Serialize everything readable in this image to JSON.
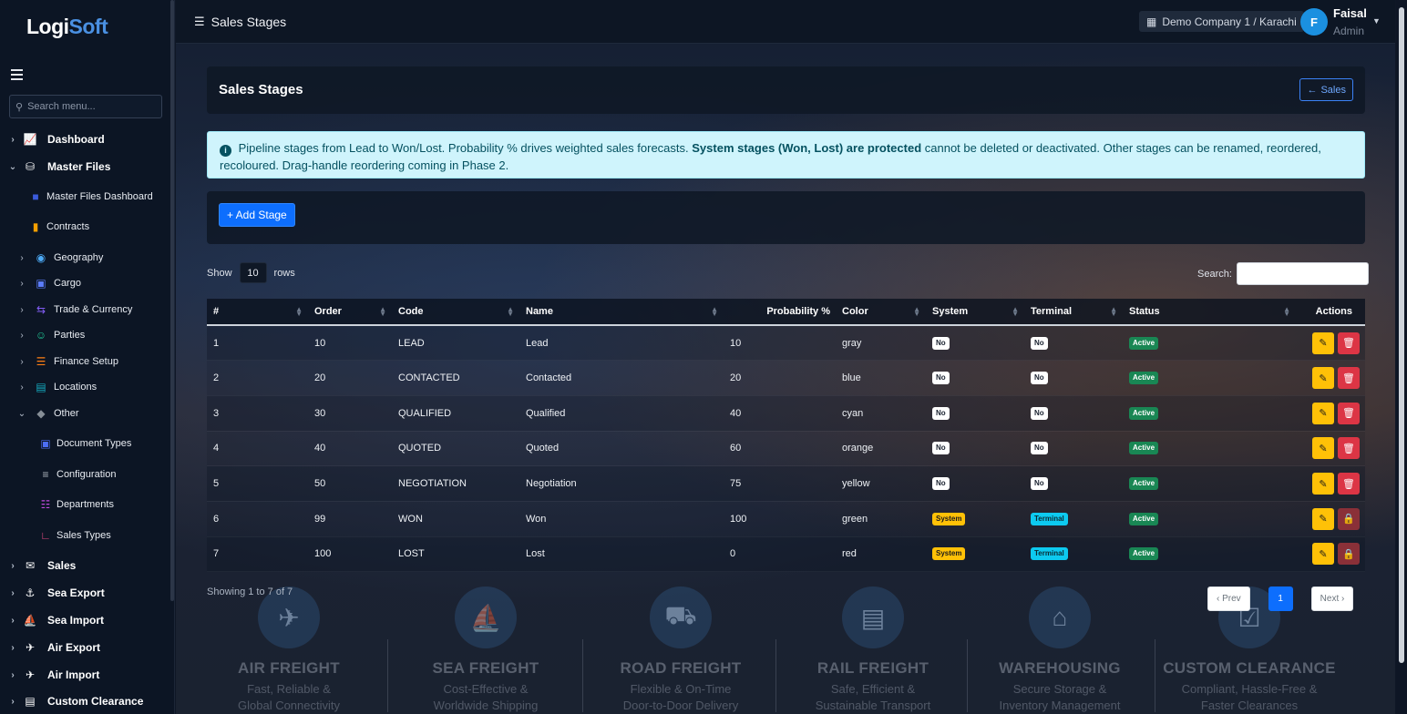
{
  "sidebar": {
    "logo_main": "Logi",
    "logo_accent": "Soft",
    "search_placeholder": "Search menu...",
    "items": [
      {
        "label": "Dashboard"
      },
      {
        "label": "Master Files"
      },
      {
        "label": "Master Files Dashboard"
      },
      {
        "label": "Contracts"
      },
      {
        "label": "Geography"
      },
      {
        "label": "Cargo"
      },
      {
        "label": "Trade & Currency"
      },
      {
        "label": "Parties"
      },
      {
        "label": "Finance Setup"
      },
      {
        "label": "Locations"
      },
      {
        "label": "Other"
      },
      {
        "label": "Document Types"
      },
      {
        "label": "Configuration"
      },
      {
        "label": "Departments"
      },
      {
        "label": "Sales Types"
      },
      {
        "label": "Sales"
      },
      {
        "label": "Sea Export"
      },
      {
        "label": "Sea Import"
      },
      {
        "label": "Air Export"
      },
      {
        "label": "Air Import"
      },
      {
        "label": "Custom Clearance"
      }
    ]
  },
  "topbar": {
    "title": "Sales Stages",
    "company": "Demo Company 1 / Karachi",
    "user_initial": "F",
    "user_name": "Faisal",
    "user_role": "Admin"
  },
  "page": {
    "heading": "Sales Stages",
    "back_label": "Sales",
    "alert_pre": "Pipeline stages from Lead to Won/Lost. Probability % drives weighted sales forecasts.",
    "alert_bold": "System stages (Won, Lost) are protected",
    "alert_post": "cannot be deleted or deactivated. Other stages can be renamed, reordered, recoloured. Drag-handle reordering coming in Phase 2.",
    "add_label": "+ Add Stage",
    "show_label": "Show",
    "page_len": "10",
    "rows_label": "rows",
    "search_label": "Search:",
    "info": "Showing 1 to 7 of 7",
    "prev_label": "‹ Prev",
    "page_num": "1",
    "next_label": "Next ›"
  },
  "table": {
    "headers": [
      "#",
      "Order",
      "Code",
      "Name",
      "Probability %",
      "Color",
      "System",
      "Terminal",
      "Status",
      "Actions"
    ],
    "rows": [
      {
        "n": "1",
        "order": "10",
        "code": "LEAD",
        "name": "Lead",
        "prob": "10",
        "color": "gray",
        "system": "No",
        "terminal": "No",
        "status": "Active",
        "locked": false
      },
      {
        "n": "2",
        "order": "20",
        "code": "CONTACTED",
        "name": "Contacted",
        "prob": "20",
        "color": "blue",
        "system": "No",
        "terminal": "No",
        "status": "Active",
        "locked": false
      },
      {
        "n": "3",
        "order": "30",
        "code": "QUALIFIED",
        "name": "Qualified",
        "prob": "40",
        "color": "cyan",
        "system": "No",
        "terminal": "No",
        "status": "Active",
        "locked": false
      },
      {
        "n": "4",
        "order": "40",
        "code": "QUOTED",
        "name": "Quoted",
        "prob": "60",
        "color": "orange",
        "system": "No",
        "terminal": "No",
        "status": "Active",
        "locked": false
      },
      {
        "n": "5",
        "order": "50",
        "code": "NEGOTIATION",
        "name": "Negotiation",
        "prob": "75",
        "color": "yellow",
        "system": "No",
        "terminal": "No",
        "status": "Active",
        "locked": false
      },
      {
        "n": "6",
        "order": "99",
        "code": "WON",
        "name": "Won",
        "prob": "100",
        "color": "green",
        "system": "System",
        "terminal": "Terminal",
        "status": "Active",
        "locked": true
      },
      {
        "n": "7",
        "order": "100",
        "code": "LOST",
        "name": "Lost",
        "prob": "0",
        "color": "red",
        "system": "System",
        "terminal": "Terminal",
        "status": "Active",
        "locked": true
      }
    ]
  },
  "services": [
    {
      "title": "AIR FREIGHT",
      "line1": "Fast, Reliable &",
      "line2": "Global Connectivity",
      "icon": "plane-icon"
    },
    {
      "title": "SEA FREIGHT",
      "line1": "Cost-Effective &",
      "line2": "Worldwide Shipping",
      "icon": "ship-icon"
    },
    {
      "title": "ROAD FREIGHT",
      "line1": "Flexible & On-Time",
      "line2": "Door-to-Door Delivery",
      "icon": "truck-icon"
    },
    {
      "title": "RAIL FREIGHT",
      "line1": "Safe, Efficient &",
      "line2": "Sustainable Transport",
      "icon": "train-icon"
    },
    {
      "title": "WAREHOUSING",
      "line1": "Secure Storage &",
      "line2": "Inventory Management",
      "icon": "warehouse-icon"
    },
    {
      "title": "CUSTOM CLEARANCE",
      "line1": "Compliant, Hassle-Free &",
      "line2": "Faster Clearances",
      "icon": "clipboard-icon"
    }
  ],
  "colors": {
    "primary": "#0d6efd",
    "active_badge": "#198754",
    "system_badge": "#ffc107",
    "terminal_badge": "#0dcaf0",
    "delete": "#dc3545"
  }
}
